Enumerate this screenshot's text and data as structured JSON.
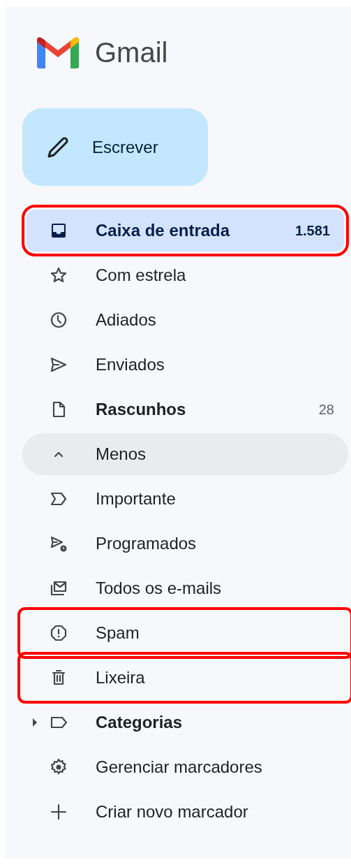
{
  "app": {
    "title": "Gmail"
  },
  "compose": {
    "label": "Escrever"
  },
  "folders": [
    {
      "kind": "inbox",
      "label": "Caixa de entrada",
      "count": "1.581",
      "selected": true,
      "unread": true,
      "hovered": false,
      "highlighted": true
    },
    {
      "kind": "starred",
      "label": "Com estrela",
      "selected": false,
      "unread": false,
      "hovered": false,
      "highlighted": false
    },
    {
      "kind": "snoozed",
      "label": "Adiados",
      "selected": false,
      "unread": false,
      "hovered": false,
      "highlighted": false
    },
    {
      "kind": "sent",
      "label": "Enviados",
      "selected": false,
      "unread": false,
      "hovered": false,
      "highlighted": false
    },
    {
      "kind": "drafts",
      "label": "Rascunhos",
      "count": "28",
      "selected": false,
      "unread": true,
      "hovered": false,
      "highlighted": false
    },
    {
      "kind": "less",
      "label": "Menos",
      "selected": false,
      "unread": false,
      "hovered": true,
      "highlighted": false
    },
    {
      "kind": "important",
      "label": "Importante",
      "selected": false,
      "unread": false,
      "hovered": false,
      "highlighted": false
    },
    {
      "kind": "scheduled",
      "label": "Programados",
      "selected": false,
      "unread": false,
      "hovered": false,
      "highlighted": false
    },
    {
      "kind": "all",
      "label": "Todos os e-mails",
      "selected": false,
      "unread": false,
      "hovered": false,
      "highlighted": false
    },
    {
      "kind": "spam",
      "label": "Spam",
      "selected": false,
      "unread": false,
      "hovered": false,
      "highlighted": true
    },
    {
      "kind": "trash",
      "label": "Lixeira",
      "selected": false,
      "unread": false,
      "hovered": false,
      "highlighted": true
    },
    {
      "kind": "categories",
      "label": "Categorias",
      "selected": false,
      "unread": true,
      "hovered": false,
      "highlighted": false,
      "expanded": false
    },
    {
      "kind": "manage",
      "label": "Gerenciar marcadores",
      "selected": false,
      "unread": false,
      "hovered": false,
      "highlighted": false
    },
    {
      "kind": "create",
      "label": "Criar novo marcador",
      "selected": false,
      "unread": false,
      "hovered": false,
      "highlighted": false
    }
  ]
}
